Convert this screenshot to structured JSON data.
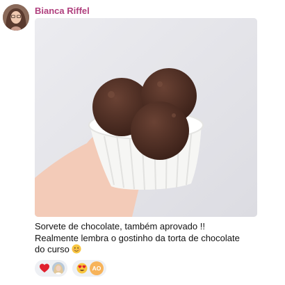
{
  "post": {
    "author": "Bianca Riffel",
    "image_subject": "",
    "message_lines": [
      "Sorvete de chocolate, também aprovado !!",
      "Realmente lembra o gostinho da torta de chocolate",
      "do curso"
    ],
    "message_emoji": "smiling-face-icon"
  },
  "reactions": [
    {
      "emoji": "heart-icon",
      "user_initials": ""
    },
    {
      "emoji": "heart-eyes-icon",
      "user_initials": "AO"
    }
  ],
  "colors": {
    "author_name": "#b0407e",
    "reaction_bg": "#eef0f4",
    "initials_bg": "#f7b35a"
  }
}
